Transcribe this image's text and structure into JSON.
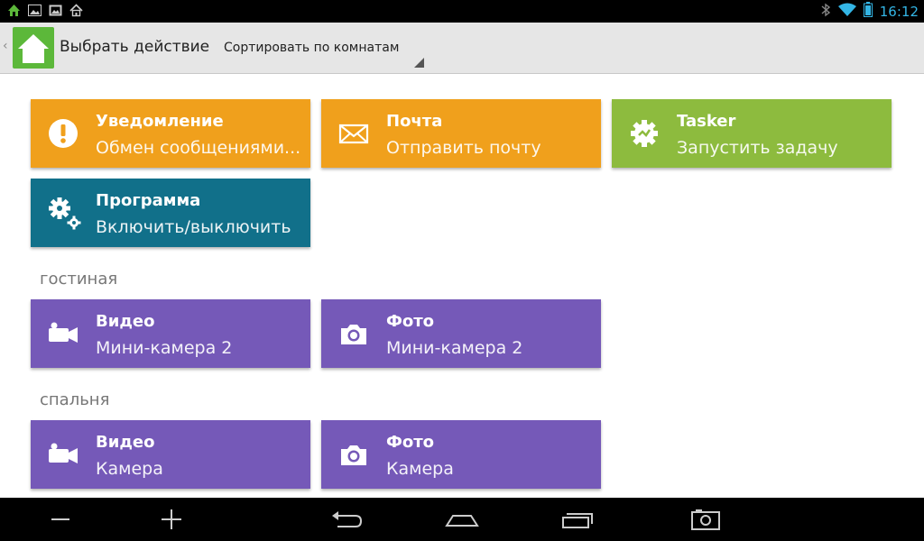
{
  "status_bar": {
    "time": "16:12",
    "left_icons": [
      "app-home-icon",
      "image-icon",
      "gallery-icon",
      "home-small-icon"
    ],
    "right_icons": [
      "bluetooth-icon",
      "wifi-icon",
      "battery-icon"
    ]
  },
  "action_bar": {
    "title": "Выбрать действие",
    "sort_label": "Сортировать по комнатам"
  },
  "tiles_top": [
    {
      "title": "Уведомление",
      "subtitle": "Обмен сообщениями...",
      "icon": "alert-icon",
      "color": "#f0a01c"
    },
    {
      "title": "Почта",
      "subtitle": "Отправить почту",
      "icon": "mail-icon",
      "color": "#f0a01c"
    },
    {
      "title": "Tasker",
      "subtitle": "Запустить задачу",
      "icon": "tasker-gear-icon",
      "color": "#8dbb3e"
    },
    {
      "title": "Программа",
      "subtitle": "Включить/выключить",
      "icon": "gears-icon",
      "color": "#11708a"
    }
  ],
  "sections": [
    {
      "name": "гостиная",
      "tiles": [
        {
          "title": "Видео",
          "subtitle": "Мини-камера 2",
          "icon": "video-camera-icon",
          "color": "#7559b8"
        },
        {
          "title": "Фото",
          "subtitle": "Мини-камера 2",
          "icon": "photo-camera-icon",
          "color": "#7559b8"
        }
      ]
    },
    {
      "name": "спальня",
      "tiles": [
        {
          "title": "Видео",
          "subtitle": "Камера",
          "icon": "video-camera-icon",
          "color": "#7559b8"
        },
        {
          "title": "Фото",
          "subtitle": "Камера",
          "icon": "photo-camera-icon",
          "color": "#7559b8"
        }
      ]
    }
  ],
  "nav_bar": {
    "buttons": [
      "volume-down-icon",
      "volume-up-icon",
      "back-icon",
      "home-icon",
      "recents-icon",
      "screenshot-icon"
    ]
  }
}
